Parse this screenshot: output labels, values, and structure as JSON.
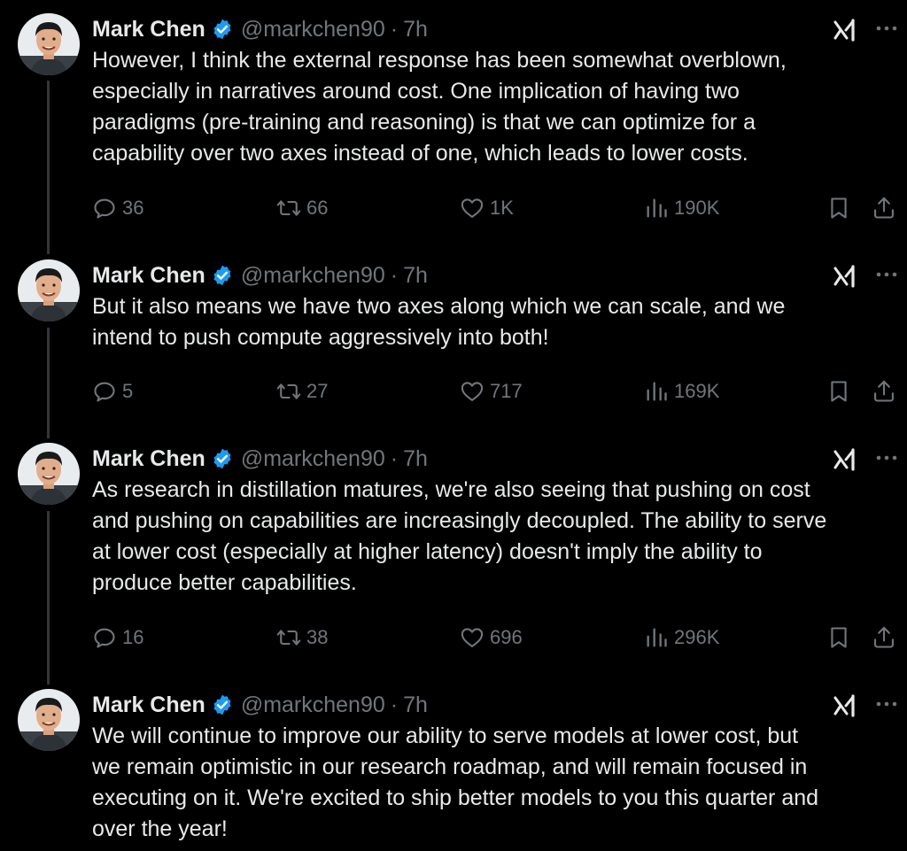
{
  "tweets": [
    {
      "name": "Mark Chen",
      "handle": "@markchen90",
      "separator": "·",
      "time": "7h",
      "text": "However, I think the external response has been somewhat overblown,\nespecially in narratives around cost. One implication of having two\nparadigms (pre-training and reasoning) is that we can optimize for a\ncapability over two axes instead of one, which leads to lower costs.",
      "replies": "36",
      "reposts": "66",
      "likes": "1K",
      "views": "190K"
    },
    {
      "name": "Mark Chen",
      "handle": "@markchen90",
      "separator": "·",
      "time": "7h",
      "text": "But it also means we have two axes along which we can scale, and we\nintend to push compute aggressively into both!",
      "replies": "5",
      "reposts": "27",
      "likes": "717",
      "views": "169K"
    },
    {
      "name": "Mark Chen",
      "handle": "@markchen90",
      "separator": "·",
      "time": "7h",
      "text": "As research in distillation matures, we're also seeing that pushing on cost\nand pushing on capabilities are increasingly decoupled. The ability to serve\nat lower cost (especially at higher latency) doesn't imply the ability to\nproduce better capabilities.",
      "replies": "16",
      "reposts": "38",
      "likes": "696",
      "views": "296K"
    },
    {
      "name": "Mark Chen",
      "handle": "@markchen90",
      "separator": "·",
      "time": "7h",
      "text": "We will continue to improve our ability to serve models at lower cost, but\nwe remain optimistic in our research roadmap, and will remain focused in\nexecuting on it. We're excited to ship better models to you this quarter and\nover the year!"
    }
  ],
  "icons": {
    "verified": "verified-badge-icon",
    "grok": "grok-icon",
    "more": "more-options-icon",
    "reply": "reply-icon",
    "repost": "repost-icon",
    "like": "like-icon",
    "views": "views-icon",
    "bookmark": "bookmark-icon",
    "share": "share-icon"
  },
  "colors": {
    "background": "#000000",
    "text": "#e7e9ea",
    "secondary": "#71767b",
    "verified": "#1d9bf0",
    "thread_line": "#333639"
  }
}
